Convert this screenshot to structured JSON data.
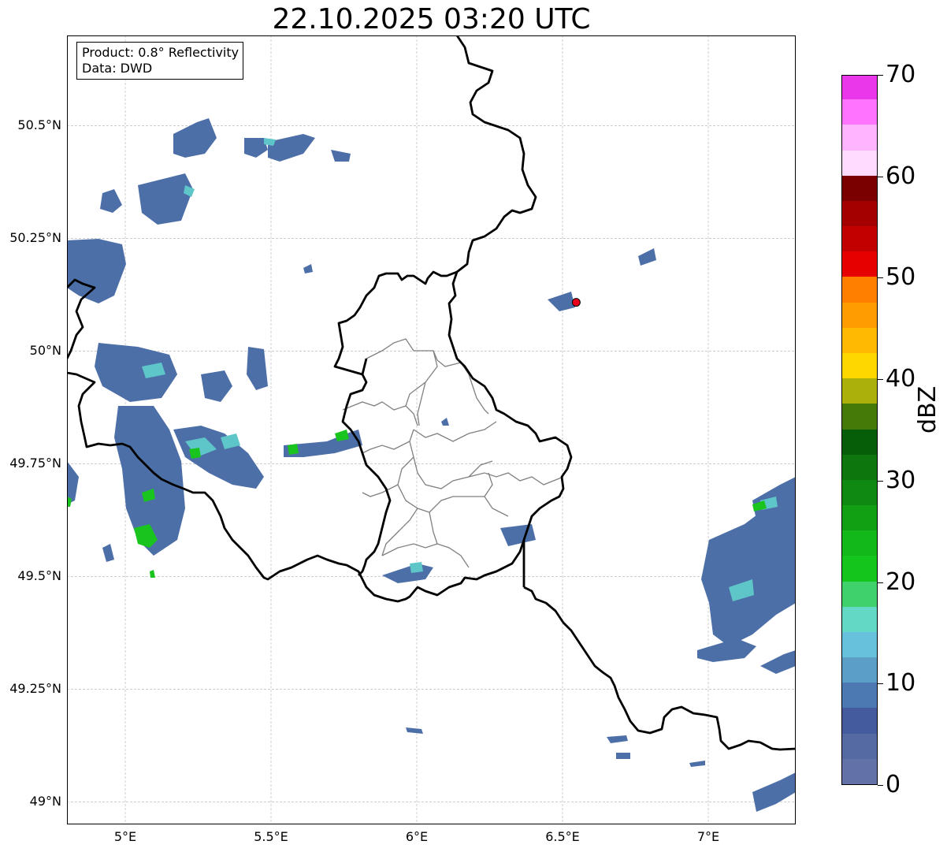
{
  "title": "22.10.2025 03:20 UTC",
  "info": {
    "product": "Product: 0.8° Reflectivity",
    "source": "Data: DWD"
  },
  "map": {
    "extent": {
      "lon": [
        4.8,
        7.3
      ],
      "lat": [
        48.95,
        50.7
      ]
    },
    "gridlines": true,
    "station_marker": {
      "lon": 6.547,
      "lat": 50.108,
      "color": "#e8001c"
    },
    "country_border_color": "#000000",
    "district_border_color": "#808080"
  },
  "axes": {
    "lat_ticks": [
      {
        "value": 50.5,
        "label": "50.5°N"
      },
      {
        "value": 50.25,
        "label": "50.25°N"
      },
      {
        "value": 50.0,
        "label": "50°N"
      },
      {
        "value": 49.75,
        "label": "49.75°N"
      },
      {
        "value": 49.5,
        "label": "49.5°N"
      },
      {
        "value": 49.25,
        "label": "49.25°N"
      },
      {
        "value": 49.0,
        "label": "49°N"
      }
    ],
    "lon_ticks": [
      {
        "value": 5.0,
        "label": "5°E"
      },
      {
        "value": 5.5,
        "label": "5.5°E"
      },
      {
        "value": 6.0,
        "label": "6°E"
      },
      {
        "value": 6.5,
        "label": "6.5°E"
      },
      {
        "value": 7.0,
        "label": "7°E"
      }
    ]
  },
  "colorbar": {
    "label": "dBZ",
    "min": 0,
    "max": 70,
    "step": 2.5,
    "ticks": [
      {
        "value": 0,
        "label": "0"
      },
      {
        "value": 10,
        "label": "10"
      },
      {
        "value": 20,
        "label": "20"
      },
      {
        "value": 30,
        "label": "30"
      },
      {
        "value": 40,
        "label": "40"
      },
      {
        "value": 50,
        "label": "50"
      },
      {
        "value": 60,
        "label": "60"
      },
      {
        "value": 70,
        "label": "70"
      }
    ],
    "colors": [
      "#6272a8",
      "#5569a2",
      "#445c9e",
      "#4d79b2",
      "#5b9fc6",
      "#67c1dc",
      "#62d8c5",
      "#3fd26c",
      "#14c51c",
      "#12b71a",
      "#119f14",
      "#0f8911",
      "#0d760c",
      "#065e08",
      "#457a09",
      "#acb00a",
      "#ffd700",
      "#ffb900",
      "#ff9d00",
      "#ff7f00",
      "#e60000",
      "#c20000",
      "#a50000",
      "#7a0000",
      "#ffdcff",
      "#ffb4ff",
      "#ff73ff",
      "#ea37ea"
    ]
  }
}
